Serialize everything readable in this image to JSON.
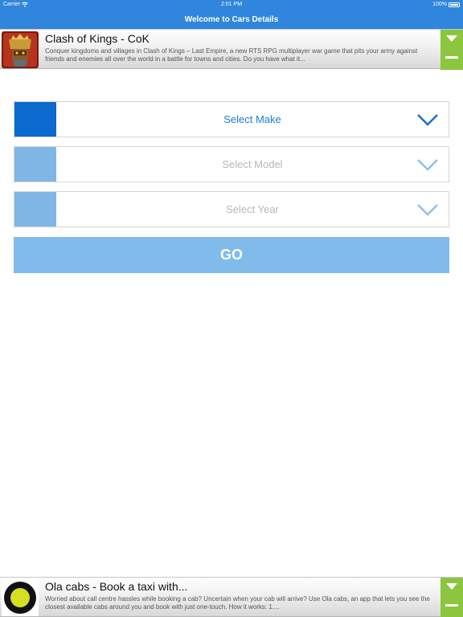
{
  "status_bar": {
    "carrier": "Carrier",
    "time": "2:01 PM",
    "battery": "100%"
  },
  "nav": {
    "title": "Welcome to Cars Details"
  },
  "ads": {
    "top": {
      "title": "Clash of Kings - CoK",
      "description": "Conquer kingdoms and villages in Clash of Kings – Last Empire, a new RTS RPG multiplayer war game that pits your army against friends and enemies all over the world in a battle for towns and cities. Do you have what it...",
      "icon": "clash-of-kings-app-icon"
    },
    "bottom": {
      "title": "Ola cabs - Book a taxi with...",
      "description": "Worried about call centre hassles while booking a cab? Uncertain when your cab will arrive? Use Ola cabs, an app that lets you see the closest available cabs around you and book with just one-touch. How it works: 1....",
      "icon": "ola-cabs-app-icon"
    }
  },
  "form": {
    "make": {
      "label": "Select Make"
    },
    "model": {
      "label": "Select Model"
    },
    "year": {
      "label": "Select Year"
    },
    "go_label": "GO"
  },
  "colors": {
    "primary": "#2f86dc",
    "active_swatch": "#0a6acd",
    "inactive_swatch": "#7fb6e6",
    "active_text": "#1b7ad6",
    "inactive_text": "#b7b7b7",
    "ad_accent": "#8cc63f"
  }
}
